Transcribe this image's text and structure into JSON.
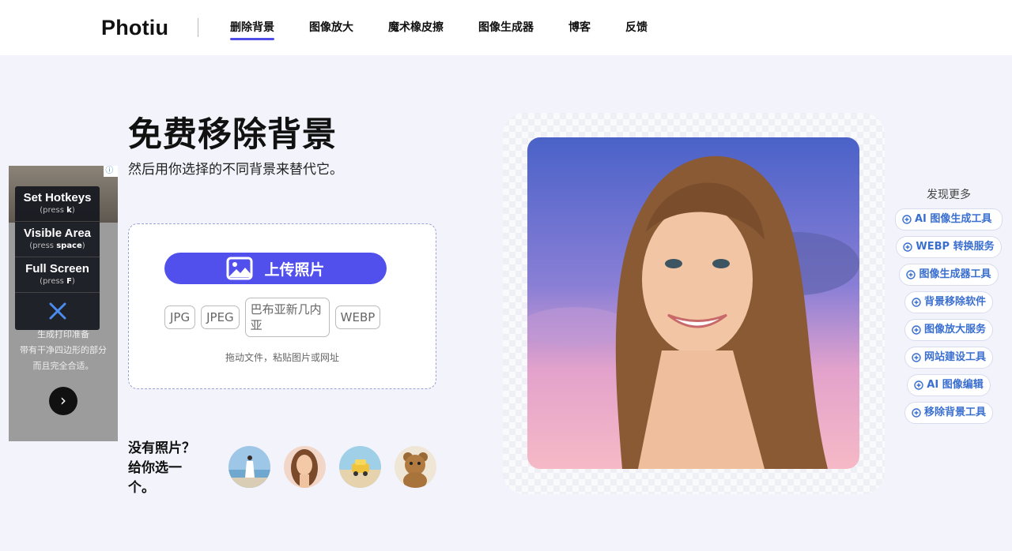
{
  "header": {
    "logo": "Photiu",
    "nav": [
      {
        "label": "删除背景",
        "active": true
      },
      {
        "label": "图像放大",
        "active": false
      },
      {
        "label": "魔术橡皮擦",
        "active": false
      },
      {
        "label": "图像生成器",
        "active": false
      },
      {
        "label": "博客",
        "active": false
      },
      {
        "label": "反馈",
        "active": false
      }
    ]
  },
  "hero": {
    "title": "免费移除背景",
    "subtitle": "然后用你选择的不同背景来替代它。"
  },
  "upload": {
    "button_label": "上传照片",
    "formats": [
      "JPG",
      "JPEG",
      "巴布亚新几内亚",
      "WEBP"
    ],
    "hint": "拖动文件，粘贴图片或网址"
  },
  "samples": {
    "prompt": "没有照片？给你选一个。",
    "items": [
      "beach-woman",
      "smiling-woman",
      "toy-car",
      "teddy-bear"
    ]
  },
  "ad": {
    "info_glyph": "ⓘ ⋮",
    "text_lines": [
      "生成打印准备",
      "带有干净四边形的部分",
      "而且完全合适。"
    ],
    "next_glyph": "›"
  },
  "hotkeys": [
    {
      "title": "Set Hotkeys",
      "hint_prefix": "(press ",
      "key": "k",
      "hint_suffix": ")"
    },
    {
      "title": "Visible Area",
      "hint_prefix": "(press ",
      "key": "space",
      "hint_suffix": ")"
    },
    {
      "title": "Full Screen",
      "hint_prefix": "(press ",
      "key": "F",
      "hint_suffix": ")"
    }
  ],
  "discover": {
    "title": "发现更多",
    "items": [
      "AI 图像生成工具",
      "WEBP 转换服务",
      "图像生成器工具",
      "背景移除软件",
      "图像放大服务",
      "网站建设工具",
      "AI 图像编辑",
      "移除背景工具"
    ]
  },
  "colors": {
    "accent": "#5250ec",
    "link": "#3a6fd0",
    "page_bg": "#f3f3fb"
  }
}
